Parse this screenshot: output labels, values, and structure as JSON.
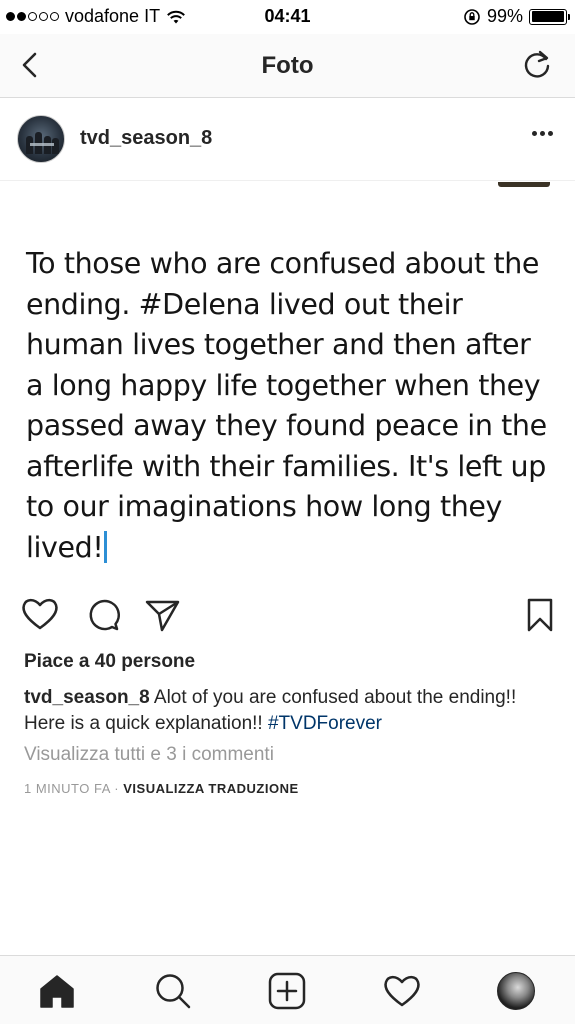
{
  "status_bar": {
    "carrier": "vodafone IT",
    "time": "04:41",
    "battery_percent": "99%",
    "battery_level": 0.99,
    "signal_bars": 2,
    "signal_total": 5
  },
  "nav": {
    "title": "Foto",
    "back_icon": "chevron-left-icon",
    "refresh_icon": "refresh-icon"
  },
  "post": {
    "username": "tvd_season_8",
    "more_icon": "more-horizontal-icon",
    "image_text": "To those who are confused about the ending. #Delena lived out their human lives together and then after a long happy life together when they passed away they found peace in the afterlife with their families. It's left up to our imaginations how long they lived!",
    "likes": "Piace a 40 persone",
    "caption_user": "tvd_season_8",
    "caption_text": " Alot of you are confused about the ending!! Here is a quick explanation!! ",
    "caption_hashtag": "#TVDForever",
    "view_comments": "Visualizza tutti e 3 i commenti",
    "time_ago": "1 MINUTO FA",
    "separator": " · ",
    "translate": "VISUALIZZA TRADUZIONE"
  },
  "tab_bar": {
    "items": [
      "home-icon",
      "search-icon",
      "add-icon",
      "heart-icon",
      "profile-avatar"
    ]
  },
  "colors": {
    "hashtag": "#003569",
    "muted": "#999999",
    "text": "#262626",
    "caret": "#2d8fd5"
  }
}
